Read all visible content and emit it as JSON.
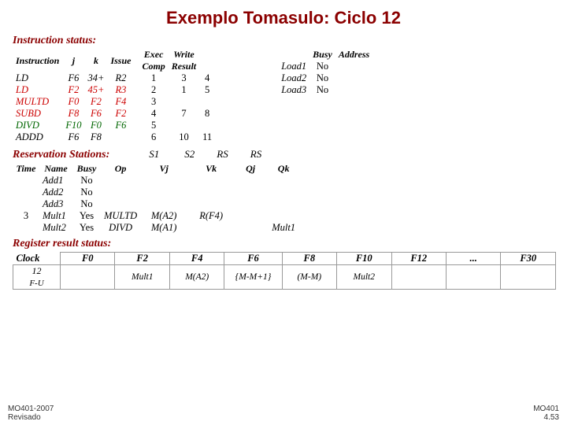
{
  "title": "Exemplo Tomasulo: Ciclo 12",
  "instruction_status": {
    "section_label": "Instruction status:",
    "columns": [
      "Instruction",
      "j",
      "k",
      "Issue",
      "Exec Comp",
      "Write Result"
    ],
    "rows": [
      {
        "name": "LD",
        "color": "black",
        "j": "F6",
        "k": "34+",
        "issue_reg": "R2",
        "issue": "1",
        "exec": "3",
        "write": "4"
      },
      {
        "name": "LD",
        "color": "red",
        "j": "F2",
        "k": "45+",
        "issue_reg": "R3",
        "issue": "2",
        "exec": "1",
        "write": "5"
      },
      {
        "name": "MULTD",
        "color": "red",
        "j": "F0",
        "k": "F2",
        "issue_reg": "F4",
        "issue": "3",
        "exec": "",
        "write": ""
      },
      {
        "name": "SUBD",
        "color": "red",
        "j": "F8",
        "k": "F6",
        "issue_reg": "F2",
        "issue": "4",
        "exec": "7",
        "write": "8"
      },
      {
        "name": "DIVD",
        "color": "green",
        "j": "F10",
        "k": "F0",
        "issue_reg": "F6",
        "issue": "5",
        "exec": "",
        "write": ""
      },
      {
        "name": "ADDD",
        "color": "black",
        "j": "F6",
        "k": "F8",
        "issue_reg": "",
        "issue": "6",
        "exec": "10",
        "write": "11"
      }
    ]
  },
  "rob_status": {
    "columns": [
      "",
      "Busy",
      "Address"
    ],
    "rows": [
      {
        "name": "Load1",
        "busy": "No",
        "address": ""
      },
      {
        "name": "Load2",
        "busy": "No",
        "address": ""
      },
      {
        "name": "Load3",
        "busy": "No",
        "address": ""
      }
    ]
  },
  "reservation_stations": {
    "section_label": "Reservation Stations:",
    "s1_label": "S1",
    "s2_label": "S2",
    "rs_qj_label": "RS",
    "rs_qk_label": "RS",
    "col_headers": [
      "Time",
      "Name",
      "Busy",
      "Op",
      "Vj",
      "Vk",
      "Qj",
      "Qk"
    ],
    "rows": [
      {
        "time": "",
        "name": "Add1",
        "busy": "No",
        "op": "",
        "vj": "",
        "vk": "",
        "qj": "",
        "qk": ""
      },
      {
        "time": "",
        "name": "Add2",
        "busy": "No",
        "op": "",
        "vj": "",
        "vk": "",
        "qj": "",
        "qk": ""
      },
      {
        "time": "",
        "name": "Add3",
        "busy": "No",
        "op": "",
        "vj": "",
        "vk": "",
        "qj": "",
        "qk": ""
      },
      {
        "time": "3",
        "name": "Mult1",
        "busy": "Yes",
        "op": "MULTD",
        "vj": "M(A2)",
        "vk": "R(F4)",
        "qj": "",
        "qk": ""
      },
      {
        "time": "",
        "name": "Mult2",
        "busy": "Yes",
        "op": "DIVD",
        "vj": "M(A1)",
        "vk": "",
        "qj": "",
        "qk": "Mult1"
      }
    ]
  },
  "register_result_status": {
    "section_label": "Register result status:",
    "clock_label": "Clock",
    "clock_value": "12",
    "fu_label": "F-U",
    "registers": [
      "F0",
      "F2",
      "F4",
      "F6",
      "F8",
      "F10",
      "F12",
      "...",
      "F30"
    ],
    "values": [
      "",
      "Mult1",
      "M(A2)",
      "{M-M+1}",
      "(M-M)",
      "Mult2",
      "",
      "",
      ""
    ]
  },
  "footer_left_line1": "MO401-2007",
  "footer_left_line2": "Revisado",
  "footer_right_line1": "MO401",
  "footer_right_line2": "4.53"
}
